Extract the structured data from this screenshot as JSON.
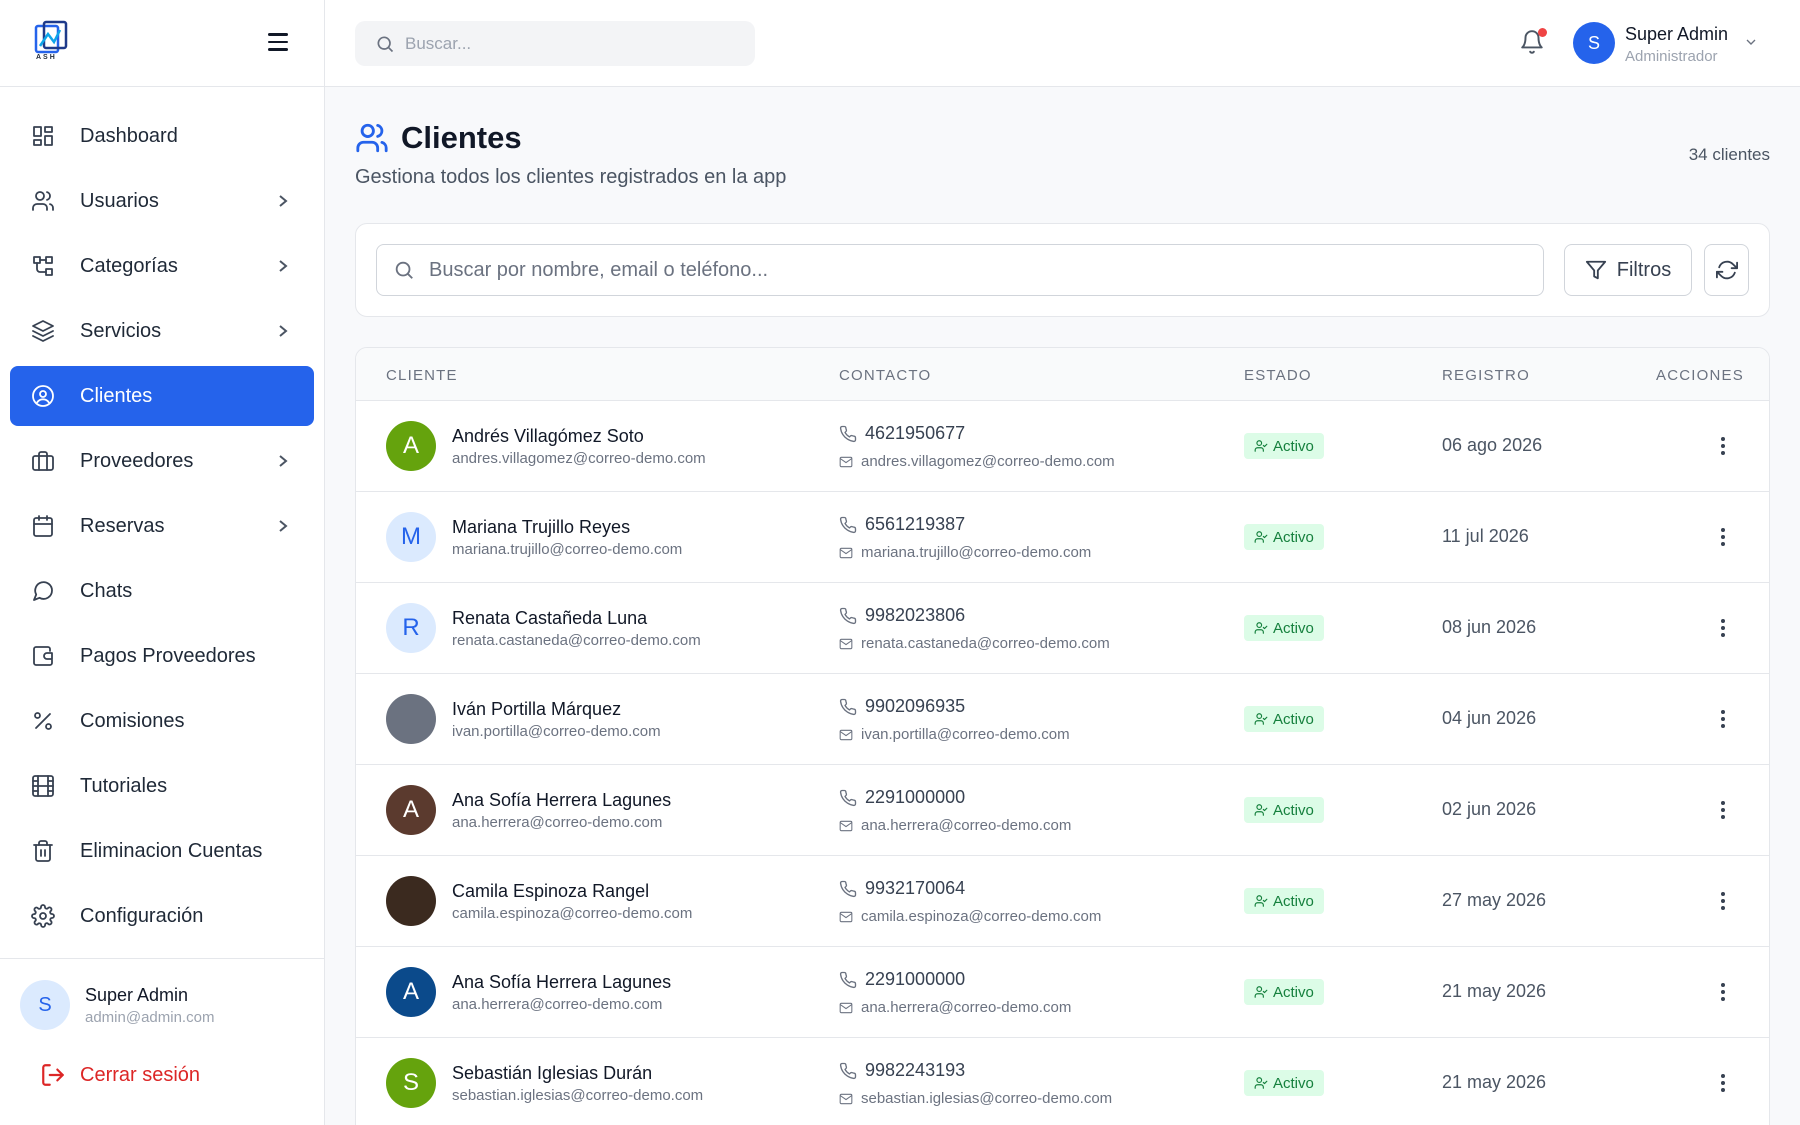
{
  "brand": {
    "logo_text": "ASH"
  },
  "topbar": {
    "search_placeholder": "Buscar...",
    "user": {
      "initial": "S",
      "name": "Super Admin",
      "role": "Administrador"
    }
  },
  "sidebar": {
    "items": [
      {
        "label": "Dashboard",
        "icon": "dashboard-icon",
        "chevron": false,
        "active": false
      },
      {
        "label": "Usuarios",
        "icon": "users-icon",
        "chevron": true,
        "active": false
      },
      {
        "label": "Categorías",
        "icon": "categories-icon",
        "chevron": true,
        "active": false
      },
      {
        "label": "Servicios",
        "icon": "layers-icon",
        "chevron": true,
        "active": false
      },
      {
        "label": "Clientes",
        "icon": "user-circle-icon",
        "chevron": false,
        "active": true
      },
      {
        "label": "Proveedores",
        "icon": "briefcase-icon",
        "chevron": true,
        "active": false
      },
      {
        "label": "Reservas",
        "icon": "calendar-icon",
        "chevron": true,
        "active": false
      },
      {
        "label": "Chats",
        "icon": "chat-icon",
        "chevron": false,
        "active": false
      },
      {
        "label": "Pagos Proveedores",
        "icon": "wallet-icon",
        "chevron": false,
        "active": false
      },
      {
        "label": "Comisiones",
        "icon": "percent-icon",
        "chevron": false,
        "active": false
      },
      {
        "label": "Tutoriales",
        "icon": "film-icon",
        "chevron": false,
        "active": false
      },
      {
        "label": "Eliminacion Cuentas",
        "icon": "trash-icon",
        "chevron": false,
        "active": false
      },
      {
        "label": "Configuración",
        "icon": "gear-icon",
        "chevron": false,
        "active": false
      }
    ],
    "footer": {
      "initial": "S",
      "name": "Super Admin",
      "email": "admin@admin.com",
      "logout_label": "Cerrar sesión"
    }
  },
  "main": {
    "title": "Clientes",
    "subtitle": "Gestiona todos los clientes registrados en la app",
    "count": "34 clientes",
    "search_placeholder": "Buscar por nombre, email o teléfono...",
    "filters_label": "Filtros",
    "table": {
      "headers": {
        "cliente": "CLIENTE",
        "contacto": "CONTACTO",
        "estado": "ESTADO",
        "registro": "REGISTRO",
        "acciones": "ACCIONES"
      },
      "rows": [
        {
          "initial": "A",
          "avatar_bg": "#65a30d",
          "avatar_fg": "#ffffff",
          "name": "Andrés Villagómez Soto",
          "email": "andres.villagomez@correo-demo.com",
          "phone": "4621950677",
          "status": "Activo",
          "date": "06 ago 2026"
        },
        {
          "initial": "M",
          "avatar_bg": "#dbeafe",
          "avatar_fg": "#2563eb",
          "name": "Mariana Trujillo Reyes",
          "email": "mariana.trujillo@correo-demo.com",
          "phone": "6561219387",
          "status": "Activo",
          "date": "11 jul 2026"
        },
        {
          "initial": "R",
          "avatar_bg": "#dbeafe",
          "avatar_fg": "#2563eb",
          "name": "Renata Castañeda Luna",
          "email": "renata.castaneda@correo-demo.com",
          "phone": "9982023806",
          "status": "Activo",
          "date": "08 jun 2026"
        },
        {
          "initial": "",
          "avatar_bg": "#6b7280",
          "avatar_fg": "#ffffff",
          "name": "Iván Portilla Márquez",
          "email": "ivan.portilla@correo-demo.com",
          "phone": "9902096935",
          "status": "Activo",
          "date": "04 jun 2026"
        },
        {
          "initial": "A",
          "avatar_bg": "#5b3a2e",
          "avatar_fg": "#ffffff",
          "name": "Ana Sofía Herrera Lagunes",
          "email": "ana.herrera@correo-demo.com",
          "phone": "2291000000",
          "status": "Activo",
          "date": "02 jun 2026"
        },
        {
          "initial": "",
          "avatar_bg": "#3b2a1f",
          "avatar_fg": "#ffffff",
          "name": "Camila Espinoza Rangel",
          "email": "camila.espinoza@correo-demo.com",
          "phone": "9932170064",
          "status": "Activo",
          "date": "27 may 2026"
        },
        {
          "initial": "A",
          "avatar_bg": "#0b4a8b",
          "avatar_fg": "#ffffff",
          "name": "Ana Sofía Herrera Lagunes",
          "email": "ana.herrera@correo-demo.com",
          "phone": "2291000000",
          "status": "Activo",
          "date": "21 may 2026"
        },
        {
          "initial": "S",
          "avatar_bg": "#65a30d",
          "avatar_fg": "#ffffff",
          "name": "Sebastián Iglesias Durán",
          "email": "sebastian.iglesias@correo-demo.com",
          "phone": "9982243193",
          "status": "Activo",
          "date": "21 may 2026"
        }
      ]
    }
  },
  "colors": {
    "accent": "#2563eb",
    "active_badge_bg": "#dcfce7",
    "active_badge_fg": "#15803d",
    "logout": "#dc2626",
    "notification_dot": "#ef4444"
  }
}
